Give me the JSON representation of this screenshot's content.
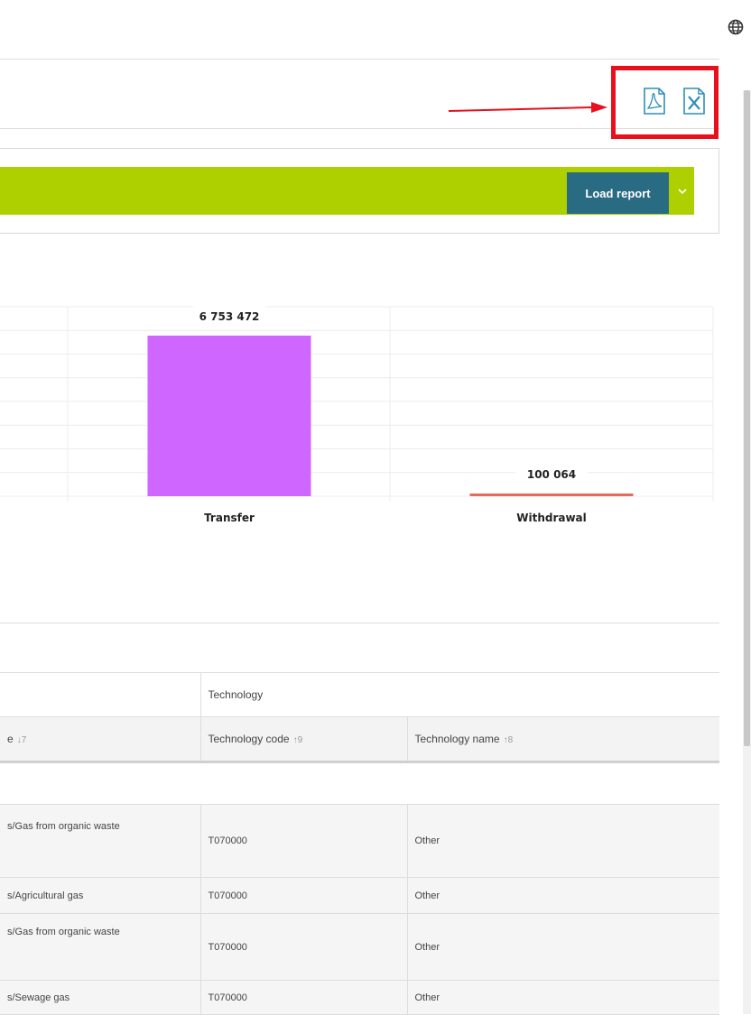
{
  "toolbar": {
    "pdf_icon": "pdf-file-icon",
    "excel_icon": "excel-file-icon"
  },
  "report_bar": {
    "load_label": "Load report",
    "accent": "#aecf00",
    "button_color": "#2a6b84"
  },
  "chart_data": {
    "type": "bar",
    "categories": [
      "Transfer",
      "Withdrawal"
    ],
    "values": [
      6753472,
      100064
    ],
    "value_labels": [
      "6 753 472",
      "100 064"
    ],
    "colors": [
      "#cf66ff",
      "#e8695a"
    ],
    "grid": true
  },
  "table": {
    "group_header": "Technology",
    "columns": [
      {
        "label": "e",
        "sort": "↓7"
      },
      {
        "label": "Technology code",
        "sort": "↑9"
      },
      {
        "label": "Technology name",
        "sort": "↑8"
      }
    ],
    "rows": [
      {
        "source": "s/Gas from organic waste",
        "code": "T070000",
        "name": "Other"
      },
      {
        "source": "s/Agricultural gas",
        "code": "T070000",
        "name": "Other"
      },
      {
        "source": "s/Gas from organic waste",
        "code": "T070000",
        "name": "Other"
      },
      {
        "source": "s/Sewage gas",
        "code": "T070000",
        "name": "Other"
      }
    ]
  }
}
